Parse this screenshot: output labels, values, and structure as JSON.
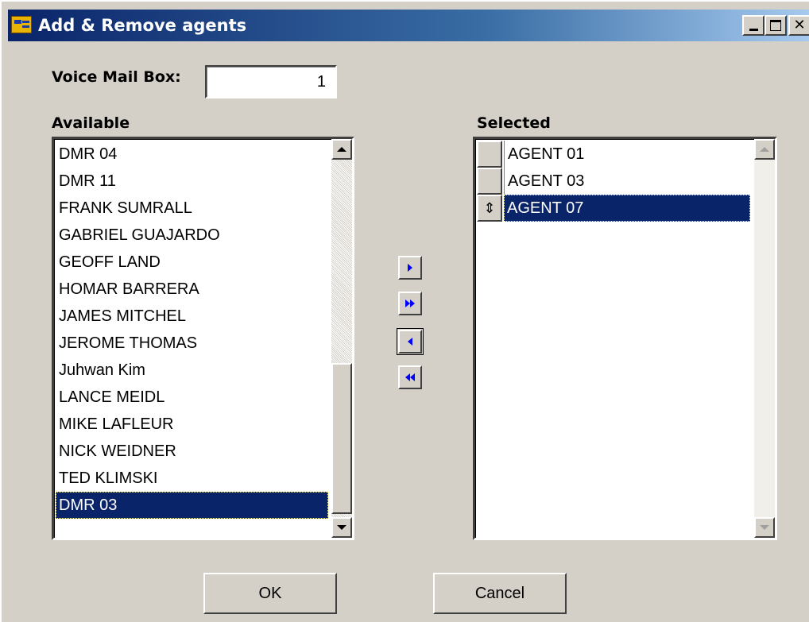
{
  "window": {
    "title": "Add & Remove agents",
    "controls": {
      "minimize": "minimize",
      "maximize": "maximize",
      "close": "✕"
    }
  },
  "voicemail": {
    "label": "Voice Mail Box:",
    "value": "1"
  },
  "available": {
    "label": "Available",
    "items": [
      "DMR 04",
      "DMR 11",
      "FRANK SUMRALL",
      "GABRIEL GUAJARDO",
      "GEOFF LAND",
      "HOMAR BARRERA",
      "JAMES MITCHEL",
      "JEROME THOMAS",
      "Juhwan Kim",
      "LANCE MEIDL",
      "MIKE LAFLEUR",
      "NICK WEIDNER",
      "TED KLIMSKI",
      "DMR 03"
    ],
    "selected_index": 13
  },
  "selected": {
    "label": "Selected",
    "items": [
      "AGENT 01",
      "AGENT 03",
      "AGENT 07"
    ],
    "selected_index": 2,
    "row_marker": "⇕"
  },
  "transfer_buttons": [
    {
      "name": "add-one-button",
      "direction": "right",
      "count": 1
    },
    {
      "name": "add-all-button",
      "direction": "right",
      "count": 2
    },
    {
      "name": "remove-one-button",
      "direction": "left",
      "count": 1
    },
    {
      "name": "remove-all-button",
      "direction": "left",
      "count": 2
    }
  ],
  "buttons": {
    "ok": "OK",
    "cancel": "Cancel"
  },
  "colors": {
    "titlebar_start": "#0a246a",
    "titlebar_end": "#a6caf0",
    "selection": "#0a246a",
    "face": "#d4d0c8",
    "arrow": "#0000ff"
  }
}
